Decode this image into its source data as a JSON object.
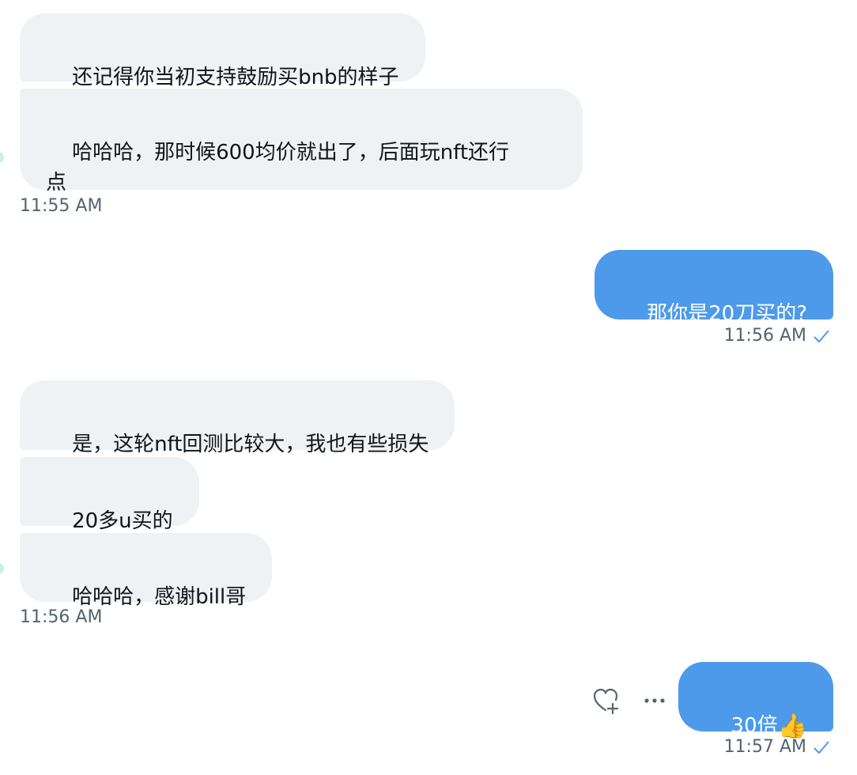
{
  "messages": {
    "m1": "还记得你当初支持鼓励买bnb的样子",
    "m2": "哈哈哈，那时候600均价就出了，后面玩nft还行\n点",
    "t1": "11:55 AM",
    "m3": "那你是20刀买的?",
    "t2": "11:56 AM",
    "m4": "是，这轮nft回测比较大，我也有些损失",
    "m5": "20多u买的",
    "m6": "哈哈哈，感谢bill哥",
    "t3": "11:56 AM",
    "m7_text": "30倍",
    "m7_emoji": "👍",
    "t4": "11:57 AM"
  },
  "icons": {
    "react": "heart-plus-icon",
    "more": "more-horizontal-icon",
    "seen": "checkmark-icon"
  },
  "colors": {
    "incoming_bubble": "#eef2f4",
    "outgoing_bubble": "#4d9aea",
    "timestamp": "#536471",
    "check": "#4d9aea"
  }
}
